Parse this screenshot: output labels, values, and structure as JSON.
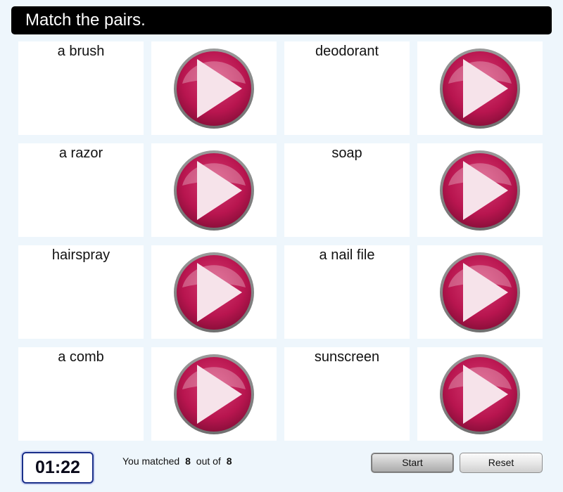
{
  "header": {
    "instruction": "Match the pairs."
  },
  "cards": [
    {
      "kind": "word",
      "text": "a brush"
    },
    {
      "kind": "audio",
      "icon": "play-icon"
    },
    {
      "kind": "word",
      "text": "deodorant"
    },
    {
      "kind": "audio",
      "icon": "play-icon"
    },
    {
      "kind": "word",
      "text": "a razor"
    },
    {
      "kind": "audio",
      "icon": "play-icon"
    },
    {
      "kind": "word",
      "text": "soap"
    },
    {
      "kind": "audio",
      "icon": "play-icon"
    },
    {
      "kind": "word",
      "text": "hairspray"
    },
    {
      "kind": "audio",
      "icon": "play-icon"
    },
    {
      "kind": "word",
      "text": "a nail file"
    },
    {
      "kind": "audio",
      "icon": "play-icon"
    },
    {
      "kind": "word",
      "text": "a comb"
    },
    {
      "kind": "audio",
      "icon": "play-icon"
    },
    {
      "kind": "word",
      "text": "sunscreen"
    },
    {
      "kind": "audio",
      "icon": "play-icon"
    }
  ],
  "footer": {
    "timer": "01:22",
    "status_prefix": "You matched",
    "matched": "8",
    "status_middle": "out of",
    "total": "8",
    "start_label": "Start",
    "reset_label": "Reset"
  },
  "colors": {
    "play_button": "#b8154f",
    "play_ring": "#707070",
    "header_bg": "#000000",
    "page_bg": "#eef6fc"
  }
}
